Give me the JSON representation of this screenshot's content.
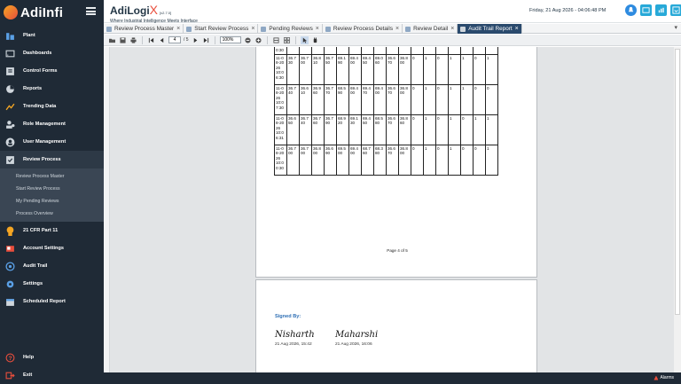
{
  "app": {
    "logo_text": "AdiInfi",
    "brand_name": "AdiLogi",
    "brand_x": "X",
    "version": "[v2.7.0]",
    "tagline": "Where Industrial Intelligence Meets Interface",
    "datetime": "Friday, 21 Aug 2026 - 04:06:48 PM"
  },
  "sidebar": {
    "items": [
      {
        "label": "Plant",
        "icon": "plant-icon"
      },
      {
        "label": "Dashboards",
        "icon": "dashboard-icon"
      },
      {
        "label": "Control Forms",
        "icon": "form-icon"
      },
      {
        "label": "Reports",
        "icon": "report-icon"
      },
      {
        "label": "Trending Data",
        "icon": "trend-icon"
      },
      {
        "label": "Role Management",
        "icon": "role-icon"
      },
      {
        "label": "User Management",
        "icon": "user-icon"
      },
      {
        "label": "Review Process",
        "icon": "review-icon"
      }
    ],
    "submenu": [
      "Review Process Master",
      "Start Review Process",
      "My Pending Reviews",
      "Process Overview"
    ],
    "items2": [
      {
        "label": "21 CFR Part 11",
        "icon": "cfr-icon"
      },
      {
        "label": "Account Settings",
        "icon": "account-icon"
      },
      {
        "label": "Audit Trail",
        "icon": "audit-icon"
      },
      {
        "label": "Settings",
        "icon": "gear-icon"
      },
      {
        "label": "Scheduled Report",
        "icon": "schedule-icon"
      }
    ],
    "help": "Help",
    "exit": "Exit"
  },
  "tabs": [
    {
      "label": "Review Process Master"
    },
    {
      "label": "Start Review Process"
    },
    {
      "label": "Pending Reviews"
    },
    {
      "label": "Review Process Details"
    },
    {
      "label": "Review Detail"
    },
    {
      "label": "Audit Trail Report"
    }
  ],
  "toolbar": {
    "page_current": "4",
    "page_total": "/ 5",
    "zoom": "100%"
  },
  "report": {
    "partial_row_time": "0:30",
    "rows": [
      {
        "time": [
          "11-0",
          "8-20",
          "26",
          "10:0",
          "6:30"
        ],
        "vals": [
          "36.7\n30",
          "36.7\n00",
          "36.8\n10",
          "36.7\n50",
          "69.1\n90",
          "69.4\n00",
          "69.4\n50",
          "69.0\n60",
          "36.6\n70",
          "36.8\n00"
        ],
        "flags": [
          "0",
          "1",
          "0",
          "1",
          "1",
          "0",
          "1"
        ]
      },
      {
        "time": [
          "11-0",
          "8-20",
          "26",
          "10:0",
          "7:30"
        ],
        "vals": [
          "36.7\n40",
          "36.6\n10",
          "36.9\n60",
          "36.7\n70",
          "68.5\n90",
          "69.4\n00",
          "69.4\n70",
          "69.4\n00",
          "36.6\n70",
          "36.8\n00"
        ],
        "flags": [
          "0",
          "1",
          "0",
          "1",
          "1",
          "0",
          "0",
          "1"
        ]
      },
      {
        "time": [
          "11-0",
          "8-20",
          "26",
          "10:0",
          "6:31"
        ],
        "vals": [
          "36.6\n50",
          "36.7\n40",
          "36.7\n60",
          "36.7\n90",
          "68.9\n20",
          "69.1\n30",
          "69.4\n50",
          "68.5\n80",
          "36.6\n70",
          "36.8\n60"
        ],
        "flags": [
          "0",
          "1",
          "0",
          "1",
          "0",
          "1",
          "1"
        ]
      },
      {
        "time": [
          "11-0",
          "8-20",
          "26",
          "10:0",
          "0:30"
        ],
        "vals": [
          "36.7\n00",
          "36.7\n00",
          "36.8\n00",
          "36.6\n90",
          "69.5\n00",
          "69.4\n00",
          "68.7\n60",
          "68.3\n80",
          "36.6\n70",
          "36.8\n00"
        ],
        "flags": [
          "0",
          "1",
          "0",
          "1",
          "0",
          "0",
          "1"
        ]
      }
    ],
    "page_footer": "Page 4 of 5",
    "signed_by_label": "Signed By:",
    "signatures": [
      {
        "name": "Nisharth",
        "date": "21 Aug 2026, 15:42"
      },
      {
        "name": "Maharshi",
        "date": "21 Aug 2026, 16:06"
      }
    ]
  },
  "footer": {
    "alarms_label": "Alarms"
  },
  "colors": {
    "sidebar_bg": "#1f2a36",
    "active_tab": "#2a4a6d",
    "signed_by": "#2e6fb5",
    "brand_accent": "#e94e3c"
  }
}
